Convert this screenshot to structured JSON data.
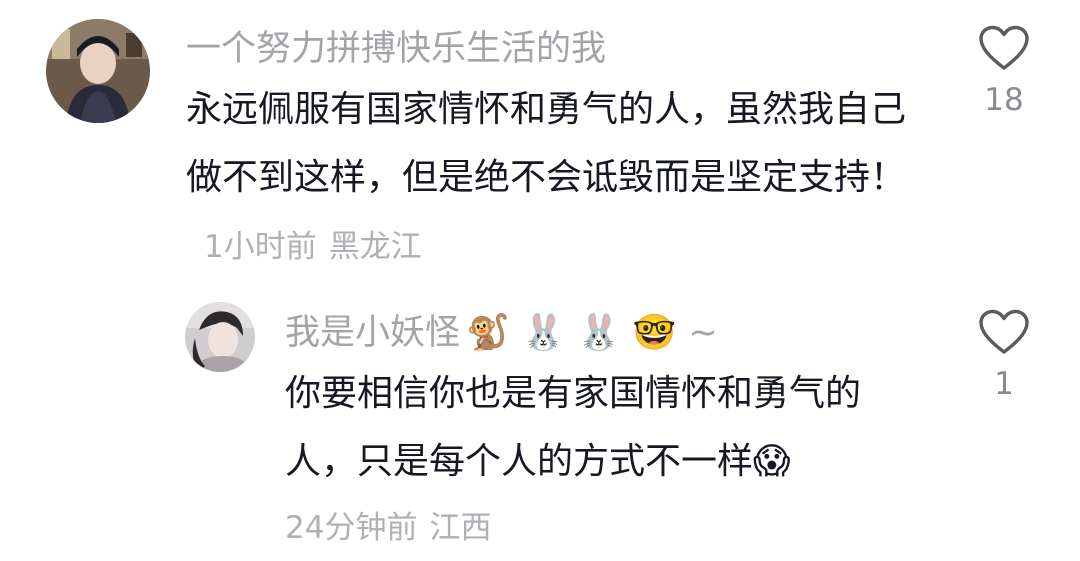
{
  "comment": {
    "username": "一个努力拼搏快乐生活的我",
    "text": "永远佩服有国家情怀和勇气的人，虽然我自己做不到这样，但是绝不会诋毁而是坚定支持！",
    "time": "1小时前",
    "location": "黑龙江",
    "like_count": "18",
    "icon_heart": "heart-outline",
    "avatar_icon": "user-avatar"
  },
  "reply": {
    "username": "我是小妖怪",
    "username_emojis": [
      "🐒",
      "🐰",
      "🐰",
      "🤓"
    ],
    "username_suffix": "~",
    "text": "你要相信你也是有家国情怀和勇气的人，只是每个人的方式不一样",
    "trailing_emoji": "😱",
    "time": "24分钟前",
    "location": "江西",
    "like_count": "1",
    "icon_heart": "heart-outline",
    "avatar_icon": "user-avatar"
  },
  "colors": {
    "username": "#a3a3a8",
    "body_text": "#161823",
    "meta": "#b0b0b5",
    "like_count": "#8a8a90",
    "heart_stroke": "#5b5b60"
  }
}
